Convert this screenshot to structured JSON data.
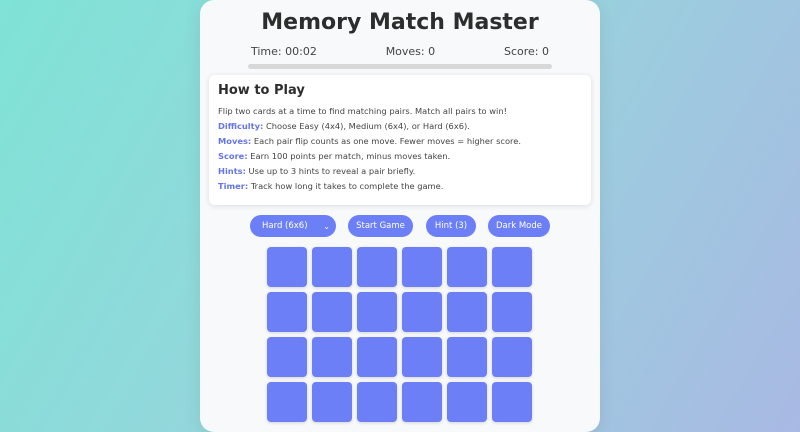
{
  "game": {
    "title": "Memory Match Master",
    "stats": {
      "time": "Time: 00:02",
      "moves": "Moves: 0",
      "score": "Score: 0"
    },
    "progress": 0
  },
  "how_to_play": {
    "heading": "How to Play",
    "intro": "Flip two cards at a time to find matching pairs. Match all pairs to win!",
    "rules": [
      {
        "key": "Difficulty:",
        "text": " Choose Easy (4x4), Medium (6x4), or Hard (6x6)."
      },
      {
        "key": "Moves:",
        "text": " Each pair flip counts as one move. Fewer moves = higher score."
      },
      {
        "key": "Score:",
        "text": " Earn 100 points per match, minus moves taken."
      },
      {
        "key": "Hints:",
        "text": " Use up to 3 hints to reveal a pair briefly."
      },
      {
        "key": "Timer:",
        "text": " Track how long it takes to complete the game."
      }
    ]
  },
  "controls": {
    "difficulty_selected": "Hard (6x6)",
    "start_label": "Start Game",
    "hint_label": "Hint (3)",
    "dark_mode_label": "Dark Mode"
  },
  "board": {
    "card_count_visible": 24,
    "card_color": "#6c7ff7"
  },
  "colors": {
    "accent": "#6c7ff7",
    "rule_key": "#6576e8"
  }
}
